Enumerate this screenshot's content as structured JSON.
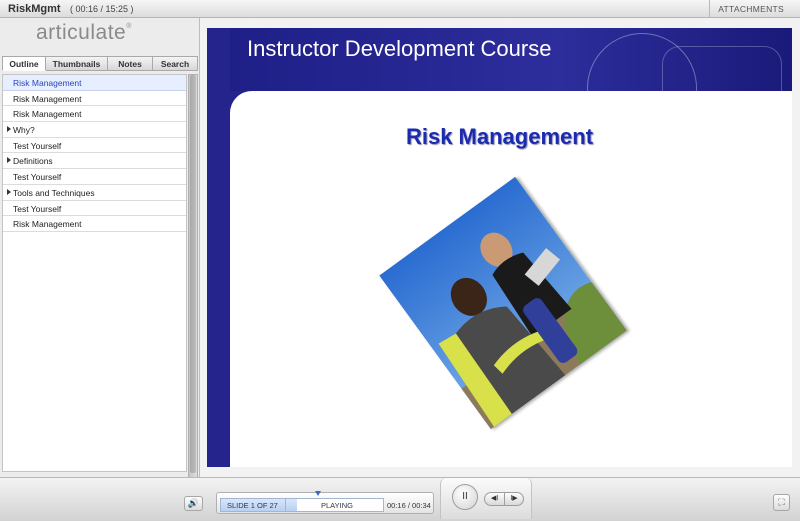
{
  "topbar": {
    "title": "RiskMgmt",
    "time": "( 00:16 / 15:25 )",
    "attachments": "ATTACHMENTS"
  },
  "sidebar": {
    "logo": "articulate",
    "logo_mark": "®",
    "tabs": [
      "Outline",
      "Thumbnails",
      "Notes",
      "Search"
    ],
    "active_tab": "Outline",
    "outline": [
      {
        "label": "Risk Management",
        "selected": true,
        "expandable": false
      },
      {
        "label": "Risk Management",
        "selected": false,
        "expandable": false
      },
      {
        "label": "Risk Management",
        "selected": false,
        "expandable": false
      },
      {
        "label": "Why?",
        "selected": false,
        "expandable": true
      },
      {
        "label": "Test Yourself",
        "selected": false,
        "expandable": false
      },
      {
        "label": "Definitions",
        "selected": false,
        "expandable": true
      },
      {
        "label": "Test Yourself",
        "selected": false,
        "expandable": false
      },
      {
        "label": "Tools and Techniques",
        "selected": false,
        "expandable": true
      },
      {
        "label": "Test Yourself",
        "selected": false,
        "expandable": false
      },
      {
        "label": "Risk Management",
        "selected": false,
        "expandable": false
      }
    ]
  },
  "slide": {
    "header": "Instructor Development Course",
    "title": "Risk Management"
  },
  "player": {
    "slide_count": "SLIDE 1 OF 27",
    "status": "PLAYING",
    "time": "00:16 / 00:34",
    "progress": 0.47,
    "pause_icon": "II",
    "prev_icon": "◀I",
    "next_icon": "I▶",
    "volume_icon": "🔊",
    "fullscreen_icon": "⛶"
  },
  "colors": {
    "accent": "#24248c",
    "title": "#1b2bb0",
    "selected_row": "#e6eeff"
  }
}
